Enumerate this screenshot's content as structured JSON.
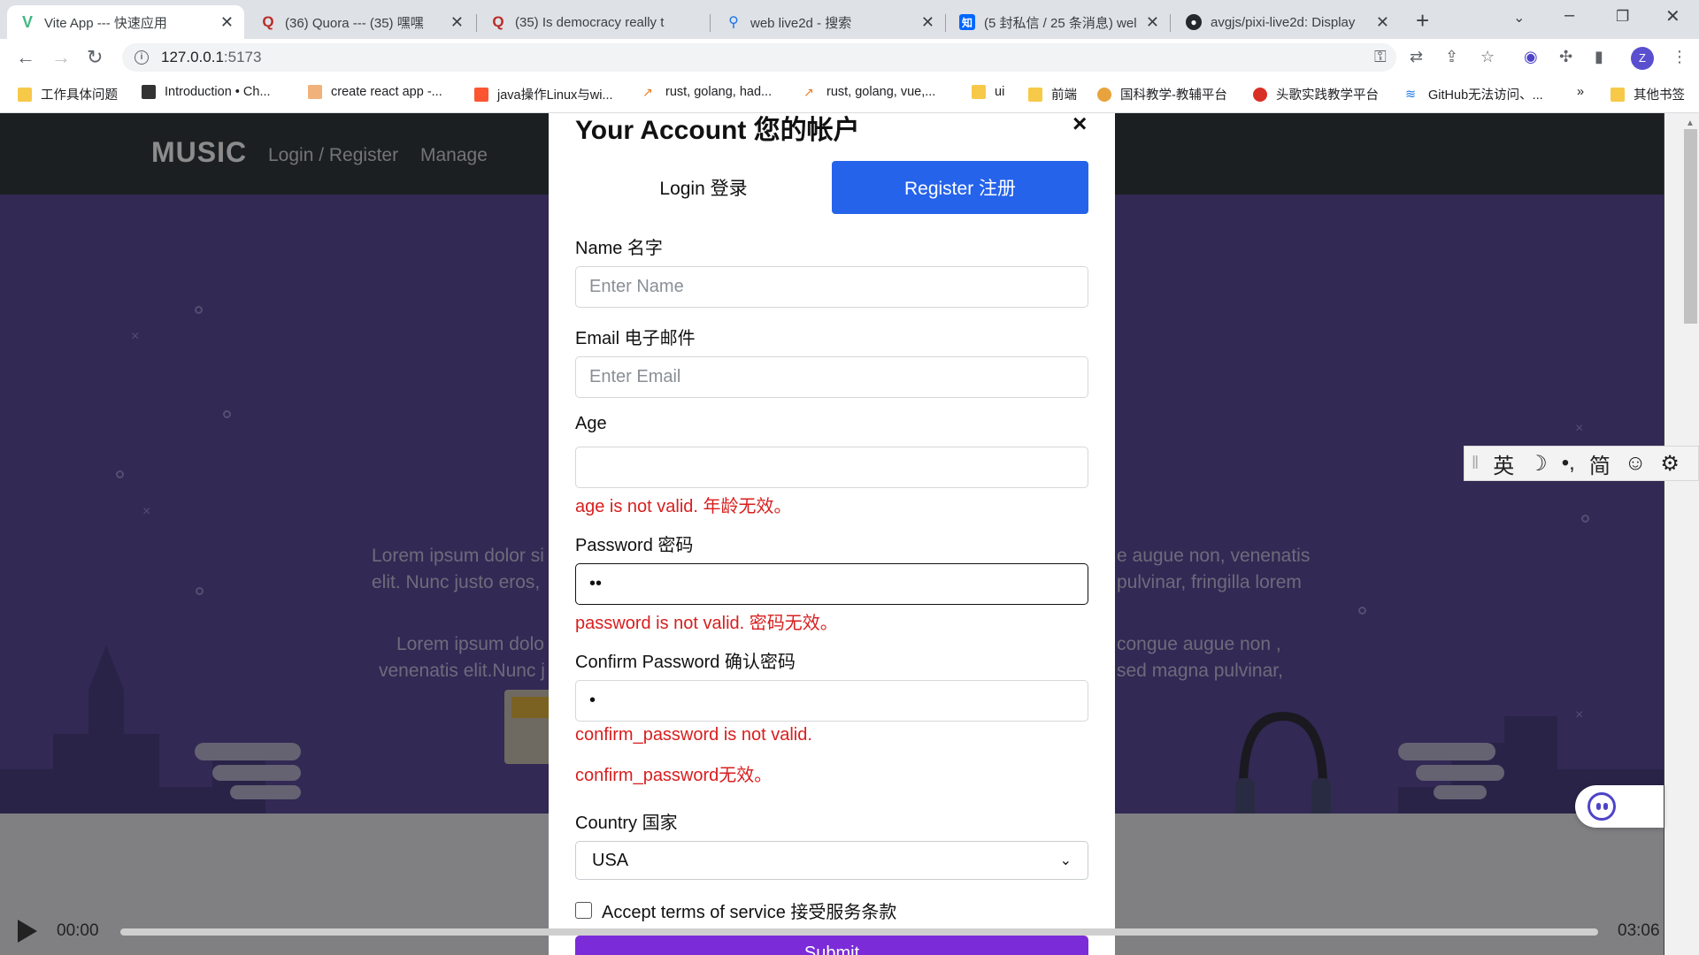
{
  "browser": {
    "tabs": [
      {
        "title": "Vite App --- 快速应用",
        "active": true,
        "favicon": "vite-icon",
        "color": "#41b883"
      },
      {
        "title": "(36) Quora ---   (35)  嘿嘿",
        "favicon": "quora-icon",
        "color": "#b92b27"
      },
      {
        "title": "(35) Is democracy really t",
        "favicon": "quora-icon",
        "color": "#b92b27"
      },
      {
        "title": "web live2d - 搜索",
        "favicon": "bing-search-icon",
        "color": "#1a73e8"
      },
      {
        "title": "(5 封私信 / 25 条消息) wel",
        "favicon": "zhihu-icon",
        "color": "#0066ff"
      },
      {
        "title": "avgjs/pixi-live2d: Display",
        "favicon": "github-icon",
        "color": "#24292e"
      }
    ],
    "url_host": "127.0.0.1",
    "url_port": ":5173",
    "profile_initial": "Z",
    "bookmarks": [
      {
        "label": "工作具体问题",
        "icon": "folder-icon"
      },
      {
        "label": "Introduction • Ch...",
        "icon": "bookmark-icon"
      },
      {
        "label": "create react app -...",
        "icon": "bookmark-icon"
      },
      {
        "label": "java操作Linux与wi...",
        "icon": "csdn-icon"
      },
      {
        "label": "rust, golang, had...",
        "icon": "trend-icon"
      },
      {
        "label": "rust, golang, vue,...",
        "icon": "trend-icon"
      },
      {
        "label": "ui",
        "icon": "folder-icon"
      },
      {
        "label": "前端",
        "icon": "folder-icon"
      },
      {
        "label": "国科教学-教辅平台",
        "icon": "bookmark-icon"
      },
      {
        "label": "头歌实践教学平台",
        "icon": "bookmark-icon"
      },
      {
        "label": "GitHub无法访问、...",
        "icon": "bookmark-icon"
      },
      {
        "label": "»",
        "icon": ""
      },
      {
        "label": "其他书签",
        "icon": "folder-icon"
      }
    ]
  },
  "site": {
    "logo": "MUSIC",
    "nav": [
      "Login / Register",
      "Manage"
    ],
    "hero_lines": [
      "Lorem ipsum dolor si",
      "elit. Nunc justo eros,",
      "Lorem ipsum dolo",
      "venenatis elit.Nunc j",
      "e augue non, venenatis",
      "pulvinar, fringilla lorem",
      "congue augue non ,",
      "sed magna pulvinar,"
    ],
    "player": {
      "current": "00:00",
      "total": "03:06",
      "progress": 0.0
    }
  },
  "modal": {
    "title": "Your Account 您的帐户",
    "close": "×",
    "tab_login": "Login 登录",
    "tab_register": "Register 注册",
    "name_label": "Name 名字",
    "name_placeholder": "Enter Name",
    "email_label": "Email 电子邮件",
    "email_placeholder": "Enter Email",
    "age_label": "Age",
    "age_value": "",
    "age_error": "age is not valid. 年龄无效。",
    "password_label": "Password 密码",
    "password_value": "••",
    "password_error": "password is not valid. 密码无效。",
    "confirm_label": "Confirm Password 确认密码",
    "confirm_value": "•",
    "confirm_error_1": "confirm_password is not valid.",
    "confirm_error_2": "confirm_password无效。",
    "country_label": "Country 国家",
    "country_value": "USA",
    "terms_label": "Accept terms of service 接受服务条款",
    "submit_label": "Submit"
  },
  "ime": {
    "lang": "英",
    "moon": "☽",
    "punct": "•,",
    "simplified": "简",
    "emoji": "☺",
    "settings": "⚙"
  }
}
